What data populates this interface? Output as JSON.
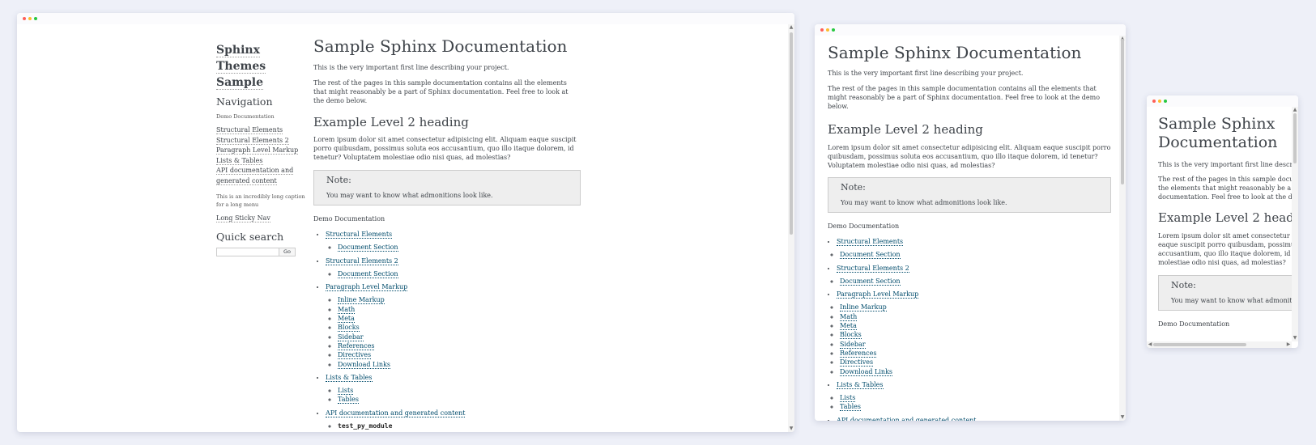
{
  "sidebar": {
    "logo_line1": "Sphinx Themes",
    "logo_line2": "Sample",
    "nav_heading": "Navigation",
    "caption": "Demo Documentation",
    "items": [
      {
        "label": "Structural Elements"
      },
      {
        "label": "Structural Elements 2"
      },
      {
        "label": "Paragraph Level Markup"
      },
      {
        "label": "Lists & Tables"
      },
      {
        "label": "API documentation and"
      },
      {
        "label": "generated content"
      }
    ],
    "long_caption": "This is an incredibly long caption for a long menu",
    "sticky_nav": "Long Sticky Nav",
    "search_heading": "Quick search",
    "search_button": "Go"
  },
  "doc": {
    "title": "Sample Sphinx Documentation",
    "intro": "This is the very important first line describing your project.",
    "para": "The rest of the pages in this sample documentation contains all the elements that might reasonably be a part of Sphinx documentation. Feel free to look at the demo below.",
    "h2": "Example Level 2 heading",
    "lorem": "Lorem ipsum dolor sit amet consectetur adipisicing elit. Aliquam eaque suscipit porro quibusdam, possimus soluta eos accusantium, quo illo itaque dolorem, id tenetur? Voluptatem molestiae odio nisi quas, ad molestias?",
    "note_title": "Note:",
    "note_text": "You may want to know what admonitions look like.",
    "toc_caption": "Demo Documentation",
    "toc": [
      {
        "label": "Structural Elements",
        "children": [
          "Document Section"
        ]
      },
      {
        "label": "Structural Elements 2",
        "children": [
          "Document Section"
        ]
      },
      {
        "label": "Paragraph Level Markup",
        "children": [
          "Inline Markup",
          "Math",
          "Meta",
          "Blocks",
          "Sidebar",
          "References",
          "Directives",
          "Download Links"
        ]
      },
      {
        "label": "Lists & Tables",
        "children": [
          "Lists",
          "Tables"
        ]
      },
      {
        "label": "API documentation and generated content",
        "children": [
          "test_py_module"
        ]
      }
    ],
    "mobile_intro_cut": "This is the very important first line describing yo",
    "mobile_para_cut": [
      "The rest of the pages in this sample documentati",
      "the elements that might reasonably be a part of S",
      "documentation. Feel free to look at the demo bel"
    ],
    "mobile_lorem_cut": [
      "Lorem ipsum dolor sit amet consectetur adipisic",
      "eaque suscipit porro quibusdam, possimus soluta",
      "accusantium, quo illo itaque dolorem, id tenetur?",
      "molestiae odio nisi quas, ad molestias?"
    ],
    "mobile_note_cut": "You may want to know what admonitions lo",
    "mobile_title_line1": "Sample Sphinx",
    "mobile_title_line2": "Documentation"
  },
  "scroll_glyphs": {
    "up": "▲",
    "down": "▼",
    "left": "◀",
    "right": "▶"
  }
}
